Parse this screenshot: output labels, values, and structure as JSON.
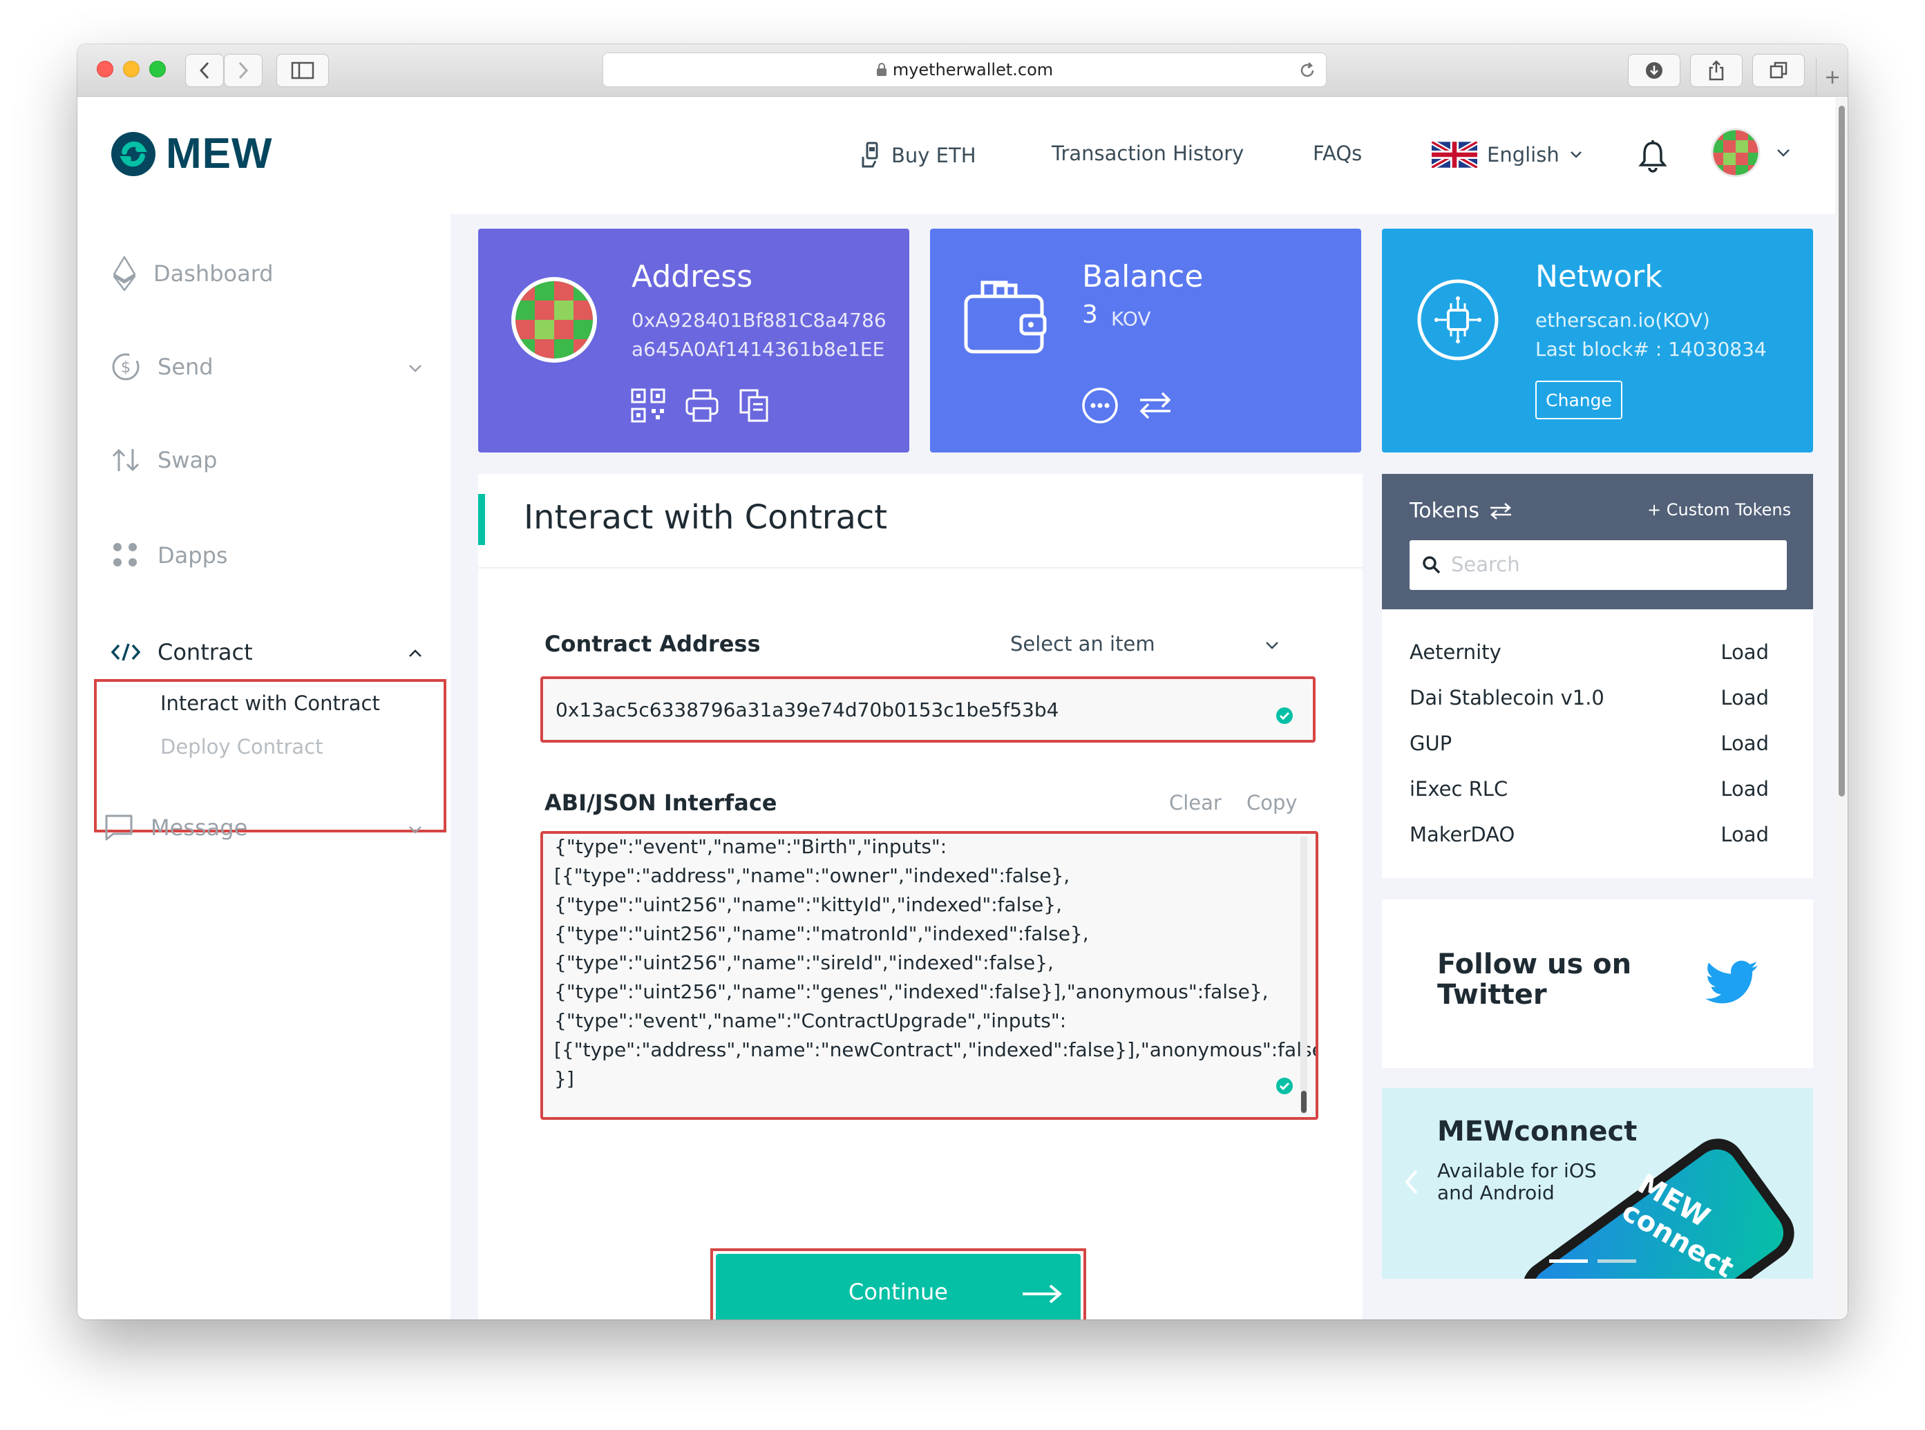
{
  "browser": {
    "url": "myetherwallet.com"
  },
  "header": {
    "logo_text": "MEW",
    "nav": {
      "buy_eth": "Buy ETH",
      "transaction_history": "Transaction History",
      "faqs": "FAQs",
      "language": "English"
    }
  },
  "sidebar": {
    "dashboard": "Dashboard",
    "send": "Send",
    "swap": "Swap",
    "dapps": "Dapps",
    "contract": "Contract",
    "contract_sub": {
      "interact": "Interact with Contract",
      "deploy": "Deploy Contract"
    },
    "message": "Message"
  },
  "cards": {
    "address": {
      "title": "Address",
      "line1": "0xA928401Bf881C8a4786",
      "line2": "a645A0Af1414361b8e1EE"
    },
    "balance": {
      "title": "Balance",
      "amount": "3",
      "unit": "KOV"
    },
    "network": {
      "title": "Network",
      "name": "etherscan.io(KOV)",
      "last_block": "Last block# : 14030834",
      "change_button": "Change"
    }
  },
  "interact": {
    "title": "Interact with Contract",
    "contract_address_label": "Contract Address",
    "select_placeholder": "Select an item",
    "contract_address_value": "0x13ac5c6338796a31a39e74d70b0153c1be5f53b4",
    "abi_label": "ABI/JSON Interface",
    "clear": "Clear",
    "copy": "Copy",
    "abi_lines": [
      "{\"type\":\"event\",\"name\":\"Birth\",\"inputs\":",
      "[{\"type\":\"address\",\"name\":\"owner\",\"indexed\":false},",
      "{\"type\":\"uint256\",\"name\":\"kittyId\",\"indexed\":false},",
      "{\"type\":\"uint256\",\"name\":\"matronId\",\"indexed\":false},",
      "{\"type\":\"uint256\",\"name\":\"sireId\",\"indexed\":false},",
      "{\"type\":\"uint256\",\"name\":\"genes\",\"indexed\":false}],\"anonymous\":false},",
      "{\"type\":\"event\",\"name\":\"ContractUpgrade\",\"inputs\":",
      "[{\"type\":\"address\",\"name\":\"newContract\",\"indexed\":false}],\"anonymous\":false",
      "}]"
    ],
    "continue_button": "Continue"
  },
  "tokens": {
    "title": "Tokens",
    "custom": "+ Custom Tokens",
    "search_placeholder": "Search",
    "load_label": "Load",
    "items": [
      "Aeternity",
      "Dai Stablecoin v1.0",
      "GUP",
      "iExec RLC",
      "MakerDAO"
    ]
  },
  "twitter": {
    "line1": "Follow us on",
    "line2": "Twitter"
  },
  "mewconnect": {
    "title": "MEWconnect",
    "line1": "Available for iOS",
    "line2": "and Android",
    "phone_text": "MEW connect"
  },
  "colors": {
    "address_card": "#6a67df",
    "balance_card": "#5a78f0",
    "network_card": "#1fa5e6",
    "accent": "#05c0a5",
    "highlight": "#d64545"
  }
}
